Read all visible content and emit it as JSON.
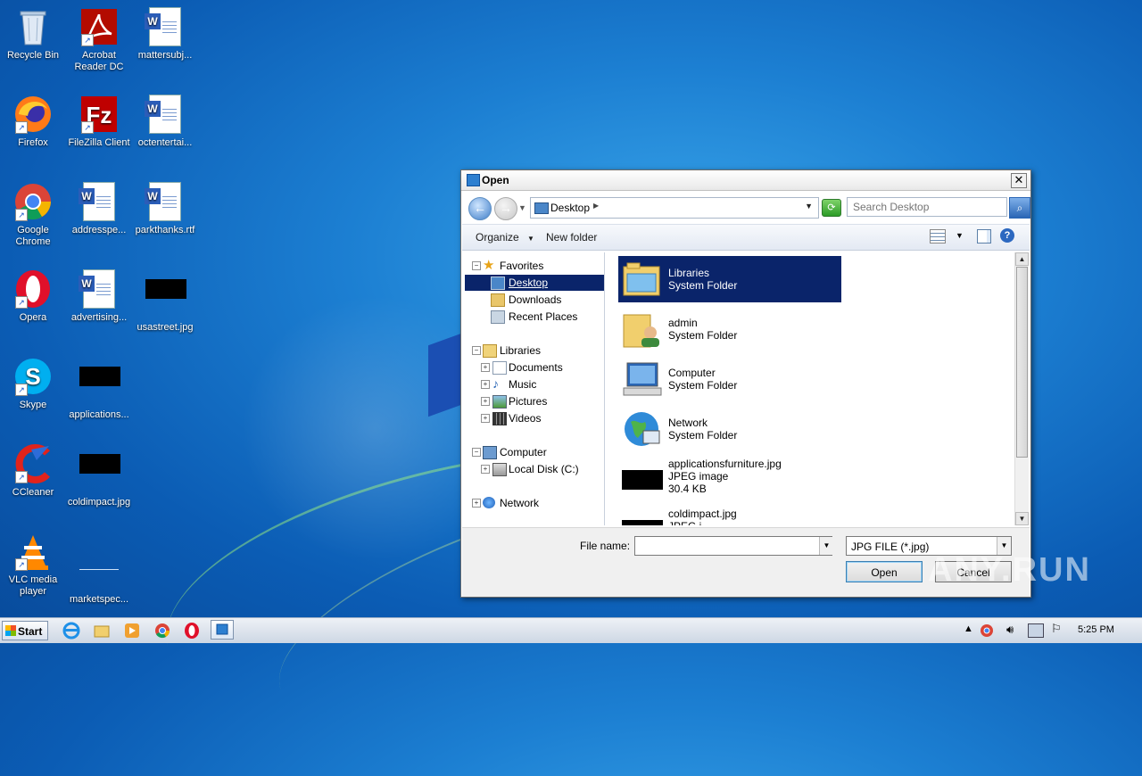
{
  "desktop": {
    "icons": [
      {
        "label": "Recycle Bin"
      },
      {
        "label": "Acrobat Reader DC"
      },
      {
        "label": "mattersubj..."
      },
      {
        "label": "Firefox"
      },
      {
        "label": "FileZilla Client"
      },
      {
        "label": "octentertai..."
      },
      {
        "label": "Google Chrome"
      },
      {
        "label": "addresspe..."
      },
      {
        "label": "parkthanks.rtf"
      },
      {
        "label": "Opera"
      },
      {
        "label": "advertising..."
      },
      {
        "label": "usastreet.jpg"
      },
      {
        "label": "Skype"
      },
      {
        "label": "applications..."
      },
      {
        "label": "CCleaner"
      },
      {
        "label": "coldimpact.jpg"
      },
      {
        "label": "VLC media player"
      },
      {
        "label": "marketspec..."
      }
    ]
  },
  "dialog": {
    "title": "Open",
    "close_label": "✕",
    "address": {
      "back_label": "←",
      "forward_label": "→",
      "path": "Desktop",
      "search_placeholder": "Search Desktop"
    },
    "toolbar": {
      "organize_label": "Organize",
      "organize_caret": "▼",
      "new_folder_label": "New folder",
      "help_label": "?"
    },
    "nav": {
      "favorites": "Favorites",
      "desktop": "Desktop",
      "downloads": "Downloads",
      "recent_places": "Recent Places",
      "libraries": "Libraries",
      "documents": "Documents",
      "music": "Music",
      "pictures": "Pictures",
      "videos": "Videos",
      "computer": "Computer",
      "local_disk": "Local Disk (C:)",
      "network": "Network"
    },
    "files": [
      {
        "name": "Libraries",
        "type": "System Folder",
        "size": ""
      },
      {
        "name": "admin",
        "type": "System Folder",
        "size": ""
      },
      {
        "name": "Computer",
        "type": "System Folder",
        "size": ""
      },
      {
        "name": "Network",
        "type": "System Folder",
        "size": ""
      },
      {
        "name": "applicationsfurniture.jpg",
        "type": "JPEG image",
        "size": "30.4 KB"
      },
      {
        "name": "coldimpact.jpg",
        "type": "JPEG i...",
        "size": ""
      }
    ],
    "bottom": {
      "file_name_label": "File name:",
      "file_name_value": "",
      "file_type": "JPG FILE (*.jpg)",
      "open_label": "Open",
      "cancel_label": "Cancel"
    }
  },
  "watermark": "ANY.RUN",
  "taskbar": {
    "start_label": "Start",
    "clock": "5:25 PM"
  },
  "colors": {
    "selection": "#0a246a",
    "desktop_bg": "#1c7fd2"
  }
}
